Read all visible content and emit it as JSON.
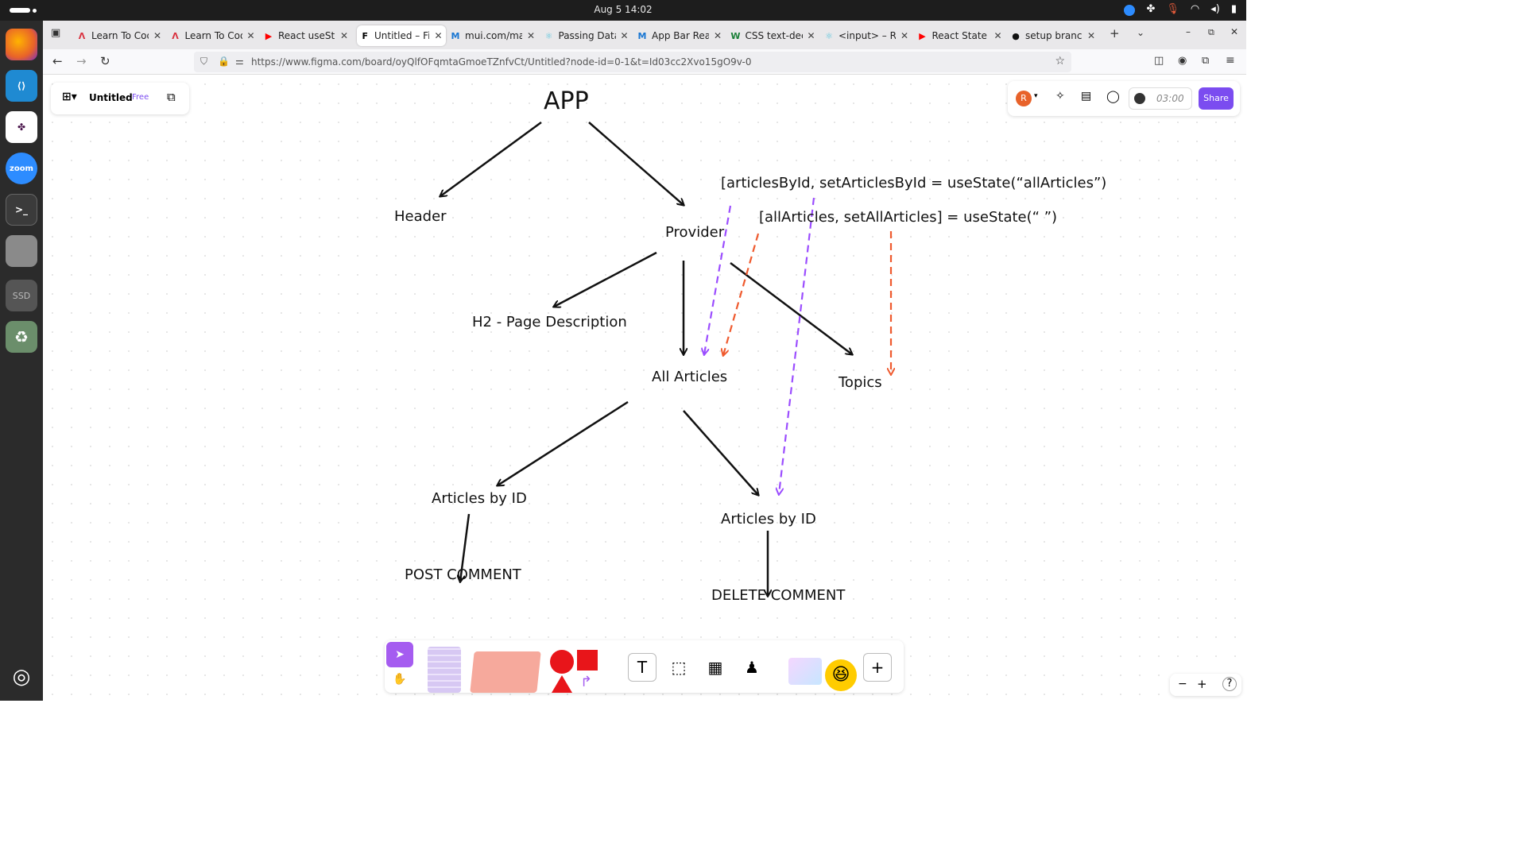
{
  "system": {
    "clock": "Aug 5  14:02",
    "tray_icons": [
      "zoom-icon",
      "slack-icon",
      "microphone-icon",
      "wifi-icon",
      "volume-icon",
      "battery-icon"
    ]
  },
  "dock": {
    "items": [
      {
        "name": "firefox-icon",
        "color": "#e8622a"
      },
      {
        "name": "vscode-icon",
        "color": "#1f8ad2"
      },
      {
        "name": "slack-icon",
        "color": "#ffffff"
      },
      {
        "name": "zoom-icon",
        "label": "zoom",
        "color": "#2d8cff"
      },
      {
        "name": "terminal-icon",
        "label": ">_",
        "color": "#3b3b3b"
      },
      {
        "name": "files-icon",
        "color": "#7a7a7a"
      },
      {
        "name": "ssd-icon",
        "label": "SSD",
        "color": "#555555"
      },
      {
        "name": "trash-icon",
        "label": "♻",
        "color": "#6b8e6b"
      },
      {
        "name": "ubuntu-icon",
        "color": "#2b2b2b"
      }
    ]
  },
  "tabs": [
    {
      "title": "Learn To Cod",
      "icon": "Λ",
      "icon_color": "#d9303e"
    },
    {
      "title": "Learn To Cod",
      "icon": "Λ",
      "icon_color": "#d9303e"
    },
    {
      "title": "React useSta",
      "icon": "▶",
      "icon_color": "#ff0000"
    },
    {
      "title": "Untitled – Fig",
      "icon": "F",
      "icon_color": "#000000",
      "active": true
    },
    {
      "title": "mui.com/mat",
      "icon": "M",
      "icon_color": "#1976d2"
    },
    {
      "title": "Passing Data",
      "icon": "⚛",
      "icon_color": "#58c4dc"
    },
    {
      "title": "App Bar Reac",
      "icon": "M",
      "icon_color": "#1976d2"
    },
    {
      "title": "CSS text-dec",
      "icon": "W",
      "icon_color": "#1a7f37"
    },
    {
      "title": "<input> – Re",
      "icon": "⚛",
      "icon_color": "#58c4dc"
    },
    {
      "title": "React State",
      "icon": "▶",
      "icon_color": "#ff0000"
    },
    {
      "title": "setup branch",
      "icon": "●",
      "icon_color": "#111111"
    }
  ],
  "nav": {
    "url": "https://www.figma.com/board/oyQlfOFqmtaGmoeTZnfvCt/Untitled?node-id=0-1&t=Id03cc2Xvo15gO9v-0"
  },
  "file_panel": {
    "title": "Untitled",
    "plan_badge": "Free"
  },
  "top_right": {
    "avatar_initial": "R",
    "timer": "03:00",
    "share_label": "Share",
    "accent": "#7b4cf0"
  },
  "diagram": {
    "nodes": {
      "app": "APP",
      "header": "Header",
      "provider": "Provider",
      "h2": "H2 - Page Description",
      "all_articles": "All Articles",
      "topics": "Topics",
      "articles_by_id_left": "Articles by ID",
      "articles_by_id_right": "Articles by ID",
      "post_comment": "POST COMMENT",
      "delete_comment": "DELETE COMMENT"
    },
    "state_notes": {
      "articles_by_id": "[articlesById, setArticlesById = useState(“allArticles”)",
      "all_articles": "[allArticles, setAllArticles] = useState(“ ”)"
    },
    "colors": {
      "arrow": "#111111",
      "purple_dashed": "#9b4dff",
      "orange_dashed": "#ef5a2e"
    }
  },
  "toolbar": {
    "tools": [
      "cursor-tool-icon",
      "hand-tool-icon",
      "sticky-note-tool",
      "paper-stack-tool",
      "shapes-tool",
      "text-tool-icon",
      "section-tool-icon",
      "table-tool-icon",
      "stamp-tool-icon",
      "widgets-tool",
      "add-tool-icon"
    ]
  },
  "zoom_controls": {
    "minus": "−",
    "plus": "+",
    "help": "?"
  }
}
